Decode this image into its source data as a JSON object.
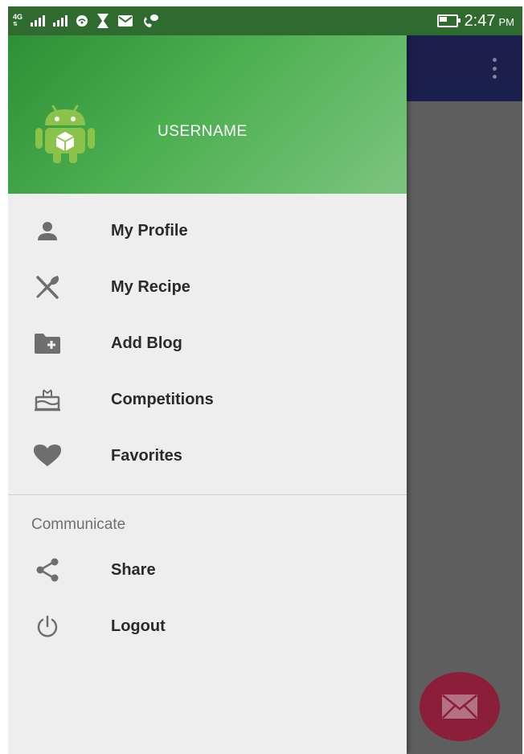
{
  "status_bar": {
    "network": "4G",
    "time": "2:47",
    "ampm": "PM"
  },
  "drawer": {
    "username": "USERNAME",
    "main_items": [
      {
        "label": "My Profile",
        "icon": "person-icon"
      },
      {
        "label": "My Recipe",
        "icon": "utensils-icon"
      },
      {
        "label": "Add Blog",
        "icon": "folder-plus-icon"
      },
      {
        "label": "Competitions",
        "icon": "cake-icon"
      },
      {
        "label": "Favorites",
        "icon": "heart-icon"
      }
    ],
    "communicate": {
      "title": "Communicate",
      "items": [
        {
          "label": "Share",
          "icon": "share-icon"
        },
        {
          "label": "Logout",
          "icon": "power-icon"
        }
      ]
    }
  },
  "colors": {
    "status_bar": "#2f6b2f",
    "header_green": "#4caf50",
    "toolbar": "#1b1f4c",
    "fab": "#8b1f3a",
    "drawer_bg": "#eeeeee",
    "scrim": "#5e5e5e"
  }
}
